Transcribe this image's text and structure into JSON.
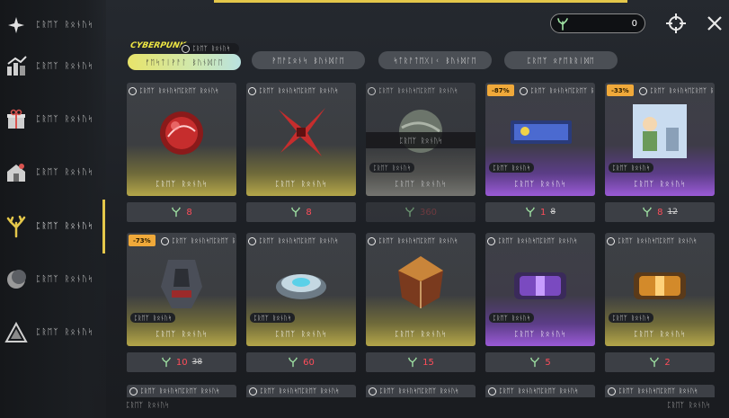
{
  "sidebar": {
    "items": [
      {
        "label": "ᛈᚱᛖᛉ ᚱᛟᚾᚢᛋ",
        "icon": "token-icon"
      },
      {
        "label": "ᛈᚱᛖᛉ ᚱᛟᚾᚢᛋ",
        "icon": "chart-up-icon"
      },
      {
        "label": "ᛈᚱᛖᛉ ᚱᛟᚾᚢᛋ",
        "icon": "gift-icon"
      },
      {
        "label": "ᛈᚱᛖᛉ ᚱᛟᚾᚢᛋ",
        "icon": "house-gift-icon"
      },
      {
        "label": "ᛈᚱᛖᛉ ᚱᛟᚾᚢᛋ",
        "icon": "coral-currency-icon"
      },
      {
        "label": "ᛈᚱᛖᛉ ᚱᛟᚾᚢᛋ",
        "icon": "moon-icon"
      },
      {
        "label": "ᛈᚱᛖᛉ ᚱᛟᚾᚢᛋ",
        "icon": "triangle-icon"
      }
    ]
  },
  "header": {
    "currency_value": "0",
    "currency_icon": "coral-currency-icon",
    "target_icon": "crosshair-icon",
    "close_icon": "close-icon"
  },
  "tabs": [
    {
      "label": "ᚠᛖᛋᛏᛁᚹᚨᛚ ᛒᚢᚾᛞᛚᛖ"
    },
    {
      "label": "ᚹᛖᚨᛈᛟᚾᛋ ᛒᚢᚾᛞᛚᛖ"
    },
    {
      "label": "ᛋᛏᚱᚨᛏᛖᚷᛁᚲ ᛒᚢᚾᛞᛚᛖ"
    },
    {
      "label": "ᛈᚱᛖᛉ ᛟᚡᛖᚱᚱᛁᛞᛖ"
    }
  ],
  "tab_badge": {
    "brand": "CYBERPUNK",
    "timer": "ᛈᚱᛖᛉ ᚱᛟᚾᚢᛋ"
  },
  "cards_row1": [
    {
      "timer": "ᛈᚱᛖᛉ ᚱᛟᚾᚢᛋᛖᛈᚱᛖᛉ ᚱᛟᚾᚢᛋ",
      "name": "ᛈᚱᛖᛉ ᚱᛟᚾᚢᛋ",
      "price": "8",
      "old": "",
      "discount": "",
      "tag": "",
      "owned": ""
    },
    {
      "timer": "ᛈᚱᛖᛉ ᚱᛟᚾᚢᛋᛖᛈᚱᛖᛉ ᚱᛟᚾᚢᛋ",
      "name": "ᛈᚱᛖᛉ ᚱᛟᚾᚢᛋ",
      "price": "8",
      "old": "",
      "discount": "",
      "tag": "",
      "owned": ""
    },
    {
      "timer": "ᛈᚱᛖᛉ ᚱᛟᚾᚢᛋᛖᛈᚱᛖᛉ ᚱᛟᚾᚢᛋ",
      "name": "ᛈᚱᛖᛉ ᚱᛟᚾᚢᛋ",
      "price": "360",
      "old": "",
      "discount": "",
      "tag": "ᛈᚱᛖᛉ ᚱᛟᚾᚢᛋ",
      "owned": "ᛈᚱᛖᛉ ᚱᛟᚾᚢᛋ"
    },
    {
      "timer": "ᛈᚱᛖᛉ ᚱᛟᚾᚢᛋᛖᛈᚱᛖᛉ ᚱᛟᚾᚢᛋ",
      "name": "ᛈᚱᛖᛉ ᚱᛟᚾᚢᛋ",
      "price": "1",
      "old": "8",
      "discount": "-87%",
      "tag": "ᛈᚱᛖᛉ ᚱᛟᚾᚢᛋ",
      "owned": ""
    },
    {
      "timer": "ᛈᚱᛖᛉ ᚱᛟᚾᚢᛋᛖᛈᚱᛖᛉ ᚱᛟᚾᚢᛋ",
      "name": "ᛈᚱᛖᛉ ᚱᛟᚾᚢᛋ",
      "price": "8",
      "old": "12",
      "discount": "-33%",
      "tag": "ᛈᚱᛖᛉ ᚱᛟᚾᚢᛋ",
      "owned": ""
    }
  ],
  "cards_row2": [
    {
      "timer": "ᛈᚱᛖᛉ ᚱᛟᚾᚢᛋᛖᛈᚱᛖᛉ ᚱᛟ",
      "name": "ᛈᚱᛖᛉ ᚱᛟᚾᚢᛋ",
      "price": "10",
      "old": "38",
      "discount": "-73%",
      "tag": "ᛈᚱᛖᛉ ᚱᛟᚾᚢᛋ",
      "owned": ""
    },
    {
      "timer": "ᛈᚱᛖᛉ ᚱᛟᚾᚢᛋᛖᛈᚱᛖᛉ ᚱᛟᚾᚢᛋ",
      "name": "ᛈᚱᛖᛉ ᚱᛟᚾᚢᛋ",
      "price": "60",
      "old": "",
      "discount": "",
      "tag": "ᛈᚱᛖᛉ ᚱᛟᚾᚢᛋ",
      "owned": ""
    },
    {
      "timer": "ᛈᚱᛖᛉ ᚱᛟᚾᚢᛋᛖᛈᚱᛖᛉ ᚱᛟᚾᚢᛋ",
      "name": "ᛈᚱᛖᛉ ᚱᛟᚾᚢᛋ",
      "price": "15",
      "old": "",
      "discount": "",
      "tag": "",
      "owned": ""
    },
    {
      "timer": "ᛈᚱᛖᛉ ᚱᛟᚾᚢᛋᛖᛈᚱᛖᛉ ᚱᛟᚾᚢᛋ",
      "name": "ᛈᚱᛖᛉ ᚱᛟᚾᚢᛋ",
      "price": "5",
      "old": "",
      "discount": "",
      "tag": "ᛈᚱᛖᛉ ᚱᛟᚾᚢᛋ",
      "owned": ""
    },
    {
      "timer": "ᛈᚱᛖᛉ ᚱᛟᚾᚢᛋᛖᛈᚱᛖᛉ ᚱᛟᚾᚢᛋ",
      "name": "ᛈᚱᛖᛉ ᚱᛟᚾᚢᛋ",
      "price": "2",
      "old": "",
      "discount": "",
      "tag": "ᛈᚱᛖᛉ ᚱᛟᚾᚢᛋ",
      "owned": ""
    }
  ],
  "row3_timers": [
    "ᛈᚱᛖᛉ ᚱᛟᚾᚢᛋᛖᛈᚱᛖᛉ ᚱᛟᚾᚢᛋ",
    "ᛈᚱᛖᛉ ᚱᛟᚾᚢᛋᛖᛈᚱᛖᛉ ᚱᛟᚾᚢᛋ",
    "ᛈᚱᛖᛉ ᚱᛟᚾᚢᛋᛖᛈᚱᛖᛉ ᚱᛟᚾᚢᛋ",
    "ᛈᚱᛖᛉ ᚱᛟᚾᚢᛋᛖᛈᚱᛖᛉ ᚱᛟᚾᚢᛋ",
    "ᛈᚱᛖᛉ ᚱᛟᚾᚢᛋᛖᛈᚱᛖᛉ ᚱᛟᚾᚢᛋ"
  ],
  "footer": {
    "left": "ᛈᚱᛖᛉ ᚱᛟᚾᚢᛋ",
    "right": "ᛈᚱᛖᛉ ᚱᛟᚾᚢᛋ"
  },
  "colors": {
    "accent": "#e4c74a",
    "price_red": "#ff4d5a",
    "discount_bg": "#f0a93a",
    "currency_green": "#9fe2a3"
  }
}
